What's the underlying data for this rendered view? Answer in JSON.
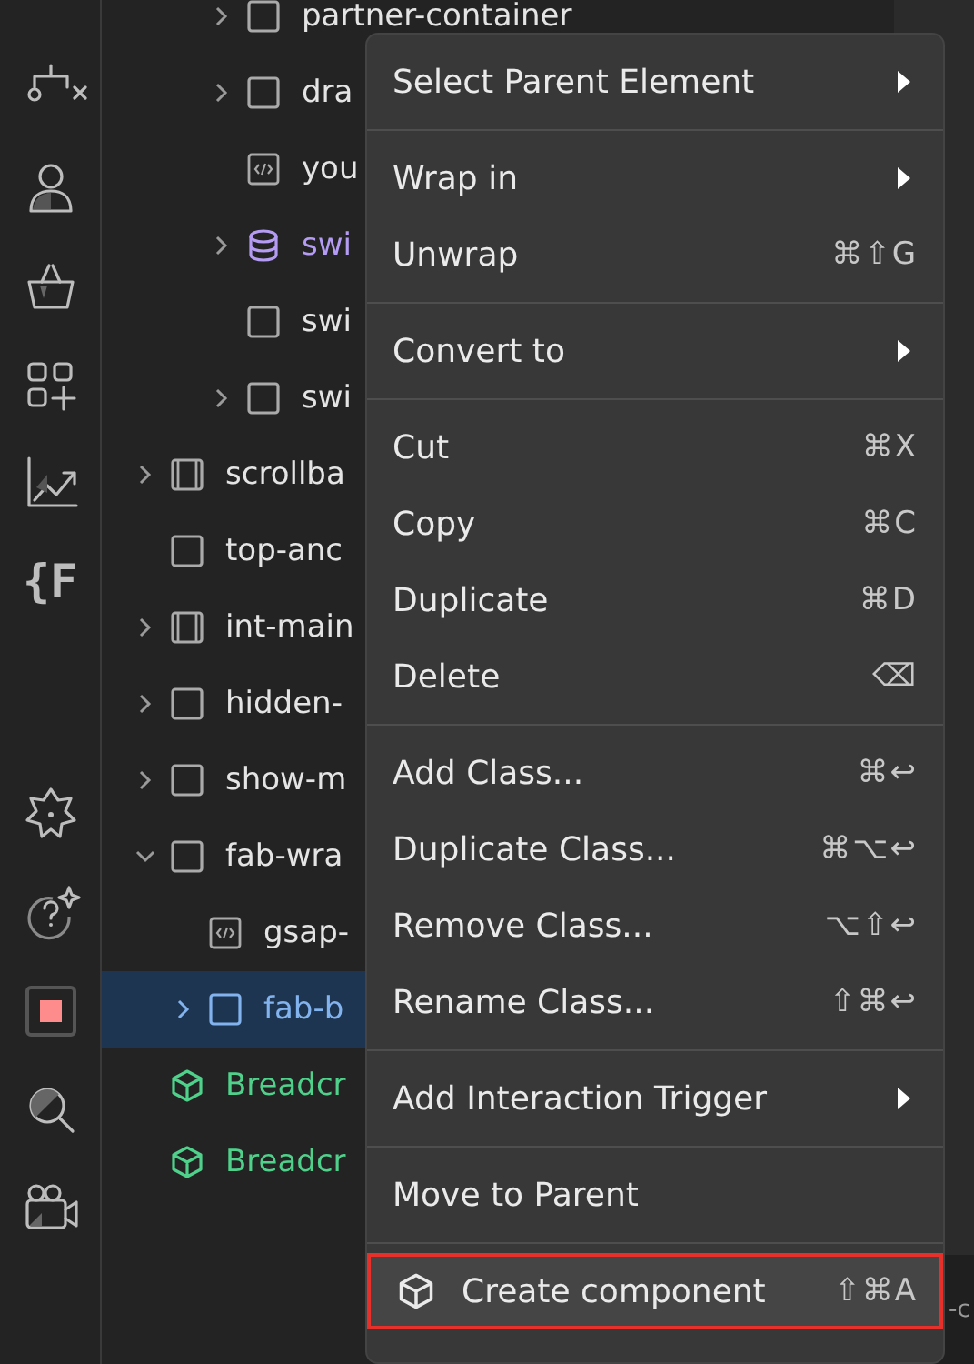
{
  "rail": [
    {
      "kind": "hierarchy"
    },
    {
      "kind": "user"
    },
    {
      "kind": "basket"
    },
    {
      "kind": "apps"
    },
    {
      "kind": "chart"
    },
    {
      "kind": "glyph",
      "text": "{F"
    },
    {
      "kind": "spacer"
    },
    {
      "kind": "gear"
    },
    {
      "kind": "help"
    },
    {
      "kind": "stop"
    },
    {
      "kind": "search"
    },
    {
      "kind": "camera"
    }
  ],
  "tree": {
    "items": [
      {
        "children": [
          {
            "children": [
              {
                "label": "partner-container",
                "kind": "box",
                "has_children": true,
                "expanded": false,
                "selected": false
              },
              {
                "label": "dra",
                "kind": "box",
                "has_children": true,
                "expanded": false,
                "selected": false
              },
              {
                "label": "you",
                "kind": "code",
                "has_children": false,
                "selected": false
              },
              {
                "label": "swi",
                "kind": "collection",
                "has_children": true,
                "expanded": false,
                "selected": false
              },
              {
                "label": "swi",
                "kind": "box",
                "has_children": false,
                "selected": false
              },
              {
                "label": "swi",
                "kind": "box",
                "has_children": true,
                "expanded": false,
                "selected": false
              }
            ]
          }
        ]
      },
      {
        "label": "scrollba",
        "kind": "section",
        "has_children": true,
        "expanded": false,
        "selected": false
      },
      {
        "label": "top-anc",
        "kind": "box",
        "has_children": false,
        "selected": false
      },
      {
        "label": "int-main",
        "kind": "section",
        "has_children": true,
        "expanded": false,
        "selected": false
      },
      {
        "label": "hidden-",
        "kind": "box",
        "has_children": true,
        "expanded": false,
        "selected": false
      },
      {
        "label": "show-m",
        "kind": "box",
        "has_children": true,
        "expanded": false,
        "selected": false
      },
      {
        "label": "fab-wra",
        "kind": "box",
        "has_children": true,
        "expanded": true,
        "selected": false,
        "children": [
          {
            "label": "gsap-",
            "kind": "code",
            "has_children": false,
            "selected": false
          },
          {
            "label": "fab-b",
            "kind": "box",
            "has_children": true,
            "expanded": false,
            "selected": true
          }
        ]
      },
      {
        "label": "Breadcr",
        "kind": "component",
        "has_children": false,
        "selected": false
      },
      {
        "label": "Breadcr",
        "kind": "component",
        "has_children": false,
        "selected": false
      }
    ]
  },
  "right_panel": {
    "text": "-c"
  },
  "context_menu": {
    "groups": [
      [
        {
          "label": "Select Parent Element",
          "submenu": true,
          "selected": false
        }
      ],
      [
        {
          "label": "Wrap in",
          "submenu": true,
          "selected": false
        },
        {
          "label": "Unwrap",
          "shortcut": "⌘⇧G",
          "submenu": false,
          "selected": false
        }
      ],
      [
        {
          "label": "Convert to",
          "submenu": true,
          "selected": false
        }
      ],
      [
        {
          "label": "Cut",
          "shortcut": "⌘X",
          "submenu": false,
          "selected": false
        },
        {
          "label": "Copy",
          "shortcut": "⌘C",
          "submenu": false,
          "selected": false
        },
        {
          "label": "Duplicate",
          "shortcut": "⌘D",
          "submenu": false,
          "selected": false
        },
        {
          "label": "Delete",
          "shortcut": "⌫",
          "submenu": false,
          "selected": false
        }
      ],
      [
        {
          "label": "Add Class...",
          "shortcut": "⌘↩",
          "submenu": false,
          "selected": false
        },
        {
          "label": "Duplicate Class...",
          "shortcut": "⌘⌥↩",
          "submenu": false,
          "selected": false
        },
        {
          "label": "Remove Class...",
          "shortcut": "⌥⇧↩",
          "submenu": false,
          "selected": false
        },
        {
          "label": "Rename Class...",
          "shortcut": "⇧⌘↩",
          "submenu": false,
          "selected": false
        }
      ],
      [
        {
          "label": "Add Interaction Trigger",
          "submenu": true,
          "selected": false
        }
      ],
      [
        {
          "label": "Move to Parent",
          "submenu": false,
          "selected": false
        }
      ],
      [
        {
          "label": "Create component",
          "kind": "component",
          "shortcut": "⇧⌘A",
          "submenu": false,
          "selected": true
        }
      ]
    ]
  }
}
